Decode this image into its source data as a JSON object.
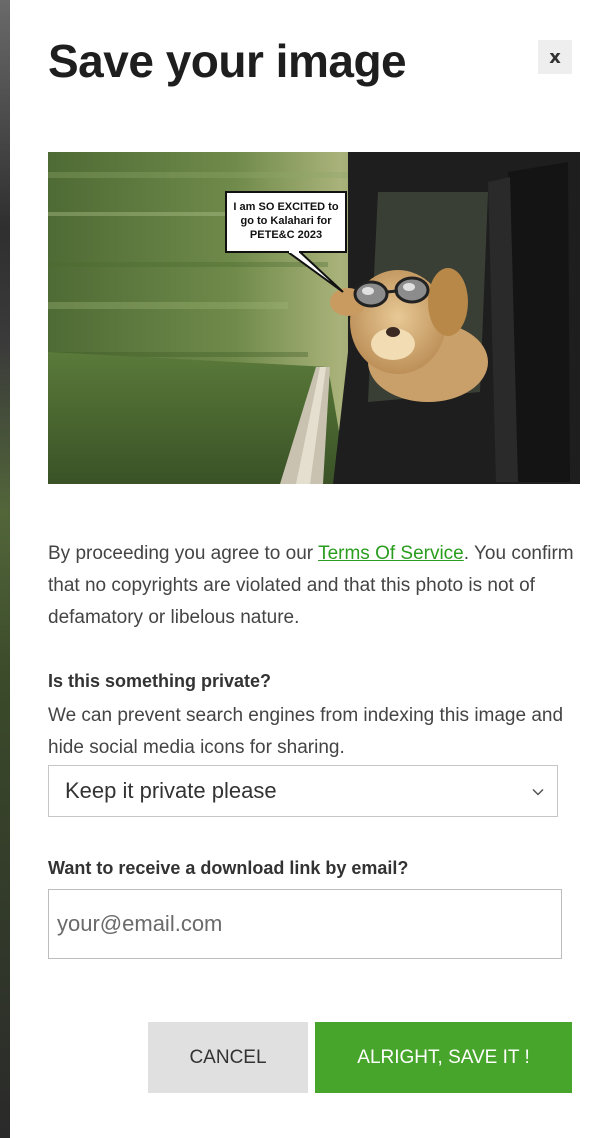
{
  "modal": {
    "title": "Save your image",
    "close_label": "x"
  },
  "preview": {
    "speech_bubble": [
      "I am SO EXCITED to",
      "go to Kalahari for",
      "PETE&C 2023"
    ]
  },
  "terms": {
    "prefix": "By proceeding you agree to our ",
    "link_label": "Terms Of Service",
    "suffix": ". You confirm that no copyrights are violated and that this photo is not of defamatory or libelous nature."
  },
  "privacy": {
    "label": "Is this something private?",
    "description": "We can prevent search engines from indexing this image and hide social media icons for sharing.",
    "selected_option": "Keep it private please"
  },
  "email": {
    "label": "Want to receive a download link by email?",
    "placeholder": "your@email.com",
    "value": ""
  },
  "actions": {
    "cancel_label": "CANCEL",
    "save_label": "ALRIGHT, SAVE IT !"
  },
  "colors": {
    "accent": "#48a52c",
    "link": "#2a9d1f",
    "cancel_bg": "#e0e0e0"
  }
}
